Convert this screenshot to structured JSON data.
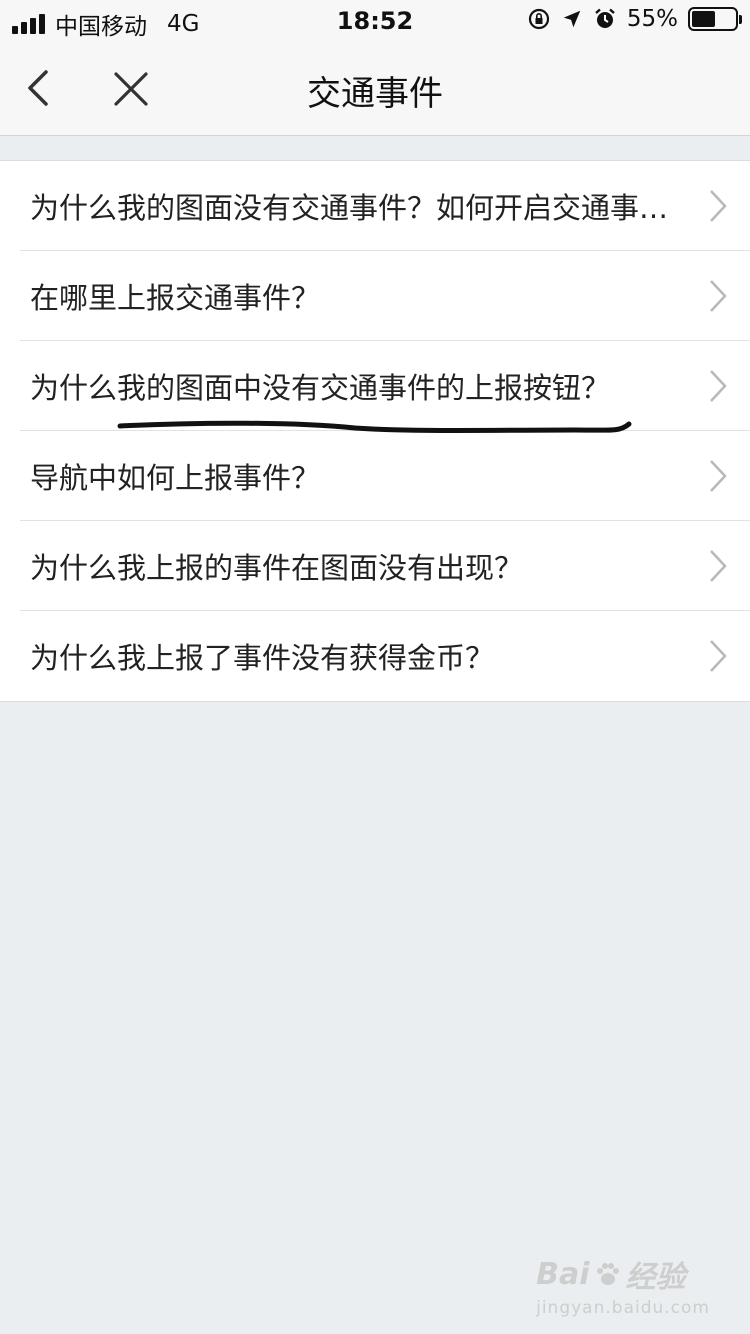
{
  "status_bar": {
    "carrier": "中国移动",
    "network": "4G",
    "time": "18:52",
    "battery": "55%",
    "battery_level": 0.55
  },
  "nav": {
    "title": "交通事件",
    "back_icon": "chevron-left-icon",
    "close_icon": "close-icon"
  },
  "faq": {
    "items": [
      {
        "label": "为什么我的图面没有交通事件？如何开启交通事件显示？"
      },
      {
        "label": "在哪里上报交通事件？"
      },
      {
        "label": "为什么我的图面中没有交通事件的上报按钮？"
      },
      {
        "label": "导航中如何上报事件？"
      },
      {
        "label": "为什么我上报的事件在图面没有出现？"
      },
      {
        "label": "为什么我上报了事件没有获得金币？"
      }
    ]
  },
  "watermark": {
    "brand": "Bai",
    "brand_suffix": "经验",
    "url": "jingyan.baidu.com"
  },
  "colors": {
    "background": "#ebeef0",
    "bar": "#f7f7f7",
    "text": "#222222",
    "chevron": "#b8b8b8"
  }
}
